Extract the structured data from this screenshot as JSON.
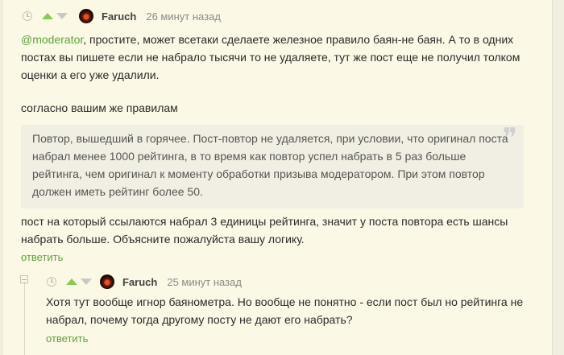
{
  "comment1": {
    "author": "Faruch",
    "time": "26 минут назад",
    "mention": "@moderator",
    "paragraph1_rest": ", простите, может всетаки сделаете железное правило баян-не баян. А то в одних постах вы пишете если не набрало тысячи то не удаляете, тут же пост еще не получил толком оценки а его уже удалили.",
    "paragraph2": "согласно вашим же правилам",
    "quote": "Повтор, вышедший в горячее. Пост-повтор не удаляется, при условии, что оригинал поста набрал менее 1000 рейтинга, в то время как повтор успел набрать в 5 раз больше рейтинга, чем оригинал к моменту обработки призыва модератором. При этом повтор должен иметь рейтинг более 50.",
    "paragraph3": "пост на который ссылаются набрал 3 единицы рейтинга, значит у поста повтора есть шансы набрать больше. Объясните пожалуйста вашу логику.",
    "reply_label": "ответить"
  },
  "comment2": {
    "author": "Faruch",
    "time": "25 минут назад",
    "text": "Хотя тут вообще игнор баянометра. Но вообще не понятно - если пост был но рейтинга не набрал, почему тогда другому посту не дают его набрать?",
    "reply_label": "ответить"
  },
  "colors": {
    "background": "#fbf8e6",
    "link": "#5aa53a",
    "upvote": "#8ac858",
    "quote_bg": "#f1efe3"
  },
  "icons": [
    "clock-icon",
    "upvote-arrow-icon",
    "downvote-arrow-icon",
    "quote-mark-icon",
    "collapse-icon"
  ]
}
